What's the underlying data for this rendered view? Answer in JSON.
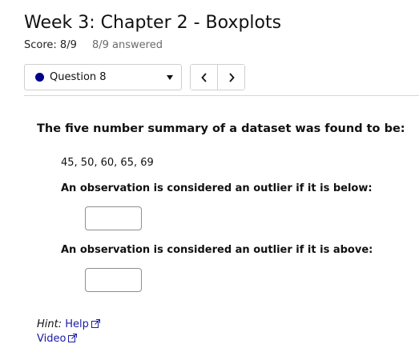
{
  "page": {
    "title": "Week 3: Chapter 2 - Boxplots",
    "score": "Score: 8/9",
    "answered": "8/9 answered"
  },
  "nav": {
    "question_select": "Question 8",
    "status_color": "#00008b",
    "prev_icon": "chevron-left-icon",
    "next_icon": "chevron-right-icon"
  },
  "question": {
    "prompt": "The five number summary of a dataset was found to be:",
    "summary": "45, 50, 60, 65, 69",
    "below_label": "An observation is considered an outlier if it is below:",
    "below_value": "",
    "above_label": "An observation is considered an outlier if it is above:",
    "above_value": ""
  },
  "hint": {
    "label": "Hint:",
    "help": "Help",
    "video": "Video",
    "link_color": "#1a1aa6"
  }
}
